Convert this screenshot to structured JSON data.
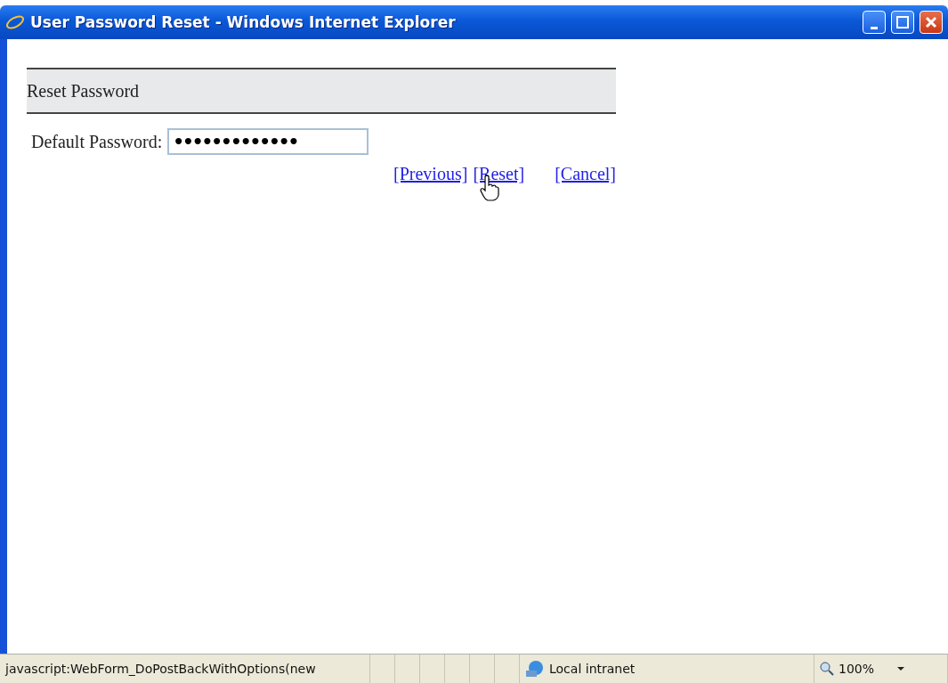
{
  "window": {
    "title": "User Password Reset - Windows Internet Explorer"
  },
  "panel": {
    "heading": "Reset Password"
  },
  "form": {
    "label": "Default Password:",
    "value": "•••••••••••••"
  },
  "links": [
    "[Previous]",
    "[Reset]",
    "[Cancel]"
  ],
  "status_bar": {
    "message": "javascript:WebForm_DoPostBackWithOptions(new",
    "zone": "Local intranet",
    "zoom": "100%"
  }
}
